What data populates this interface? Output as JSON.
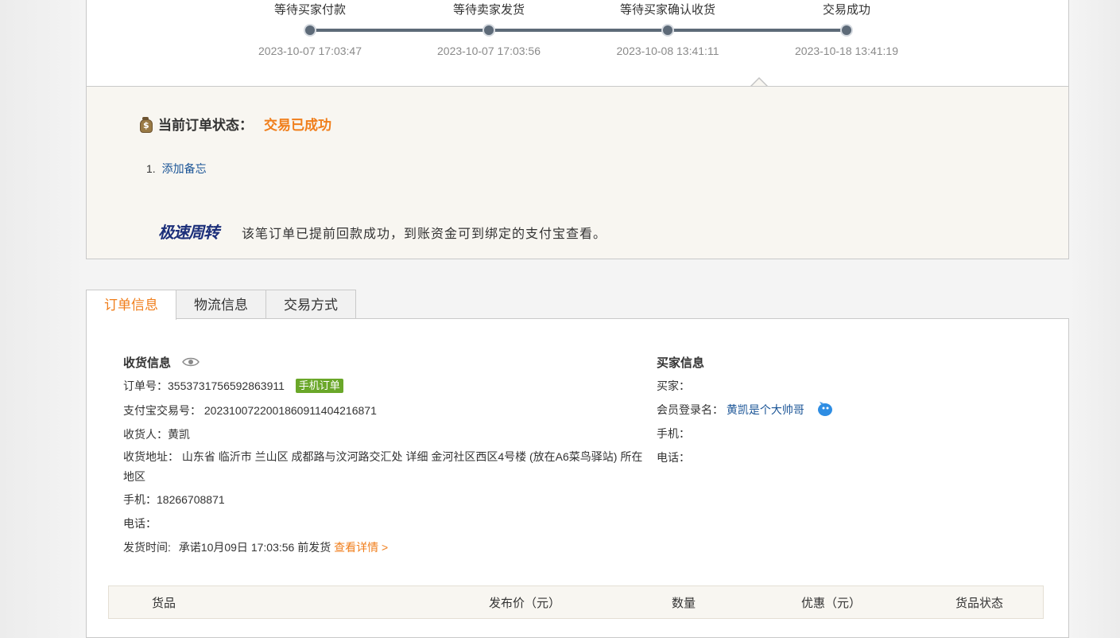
{
  "progress": {
    "steps": [
      {
        "label": "等待买家付款",
        "time": "2023-10-07 17:03:47"
      },
      {
        "label": "等待卖家发货",
        "time": "2023-10-07 17:03:56"
      },
      {
        "label": "等待买家确认收货",
        "time": "2023-10-08 13:41:11"
      },
      {
        "label": "交易成功",
        "time": "2023-10-18 13:41:19"
      }
    ]
  },
  "status": {
    "label": "当前订单状态：",
    "value": "交易已成功",
    "memo_index": "1.",
    "memo_link": "添加备忘"
  },
  "express": {
    "logo": "极速周转",
    "message": "该笔订单已提前回款成功，到账资金可到绑定的支付宝查看。"
  },
  "tabs": [
    {
      "label": "订单信息",
      "active": true
    },
    {
      "label": "物流信息",
      "active": false
    },
    {
      "label": "交易方式",
      "active": false
    }
  ],
  "shipping": {
    "title": "收货信息",
    "order_no_label": "订单号：",
    "order_no": "3553731756592863911",
    "order_badge": "手机订单",
    "alipay_label": "支付宝交易号：",
    "alipay_no": "2023100722001860911404216871",
    "receiver_label": "收货人：",
    "receiver": "黄凯",
    "address_label": "收货地址：",
    "address": "山东省 临沂市 兰山区 成都路与汶河路交汇处 详细 金河社区西区4号楼 (放在A6菜鸟驿站) 所在地区",
    "mobile_label": "手机：",
    "mobile": "18266708871",
    "phone_label": "电话：",
    "phone": "",
    "ship_time_label": "发货时间:",
    "ship_time": "承诺10月09日 17:03:56 前发货",
    "detail_link": "查看详情 >"
  },
  "buyer": {
    "title": "买家信息",
    "buyer_label": "买家：",
    "buyer": "",
    "member_label": "会员登录名：",
    "member_name": "黄凯是个大帅哥",
    "mobile_label": "手机：",
    "mobile": "",
    "phone_label": "电话：",
    "phone": ""
  },
  "goods_table": {
    "columns": [
      "货品",
      "发布价（元）",
      "数量",
      "优惠（元）",
      "货品状态"
    ]
  },
  "colors": {
    "accent_orange": "#f07e1b",
    "link_blue": "#1a5496",
    "badge_green": "#6aa729",
    "track_gray": "#5d6a78",
    "panel_beige": "#f8f6f1"
  }
}
